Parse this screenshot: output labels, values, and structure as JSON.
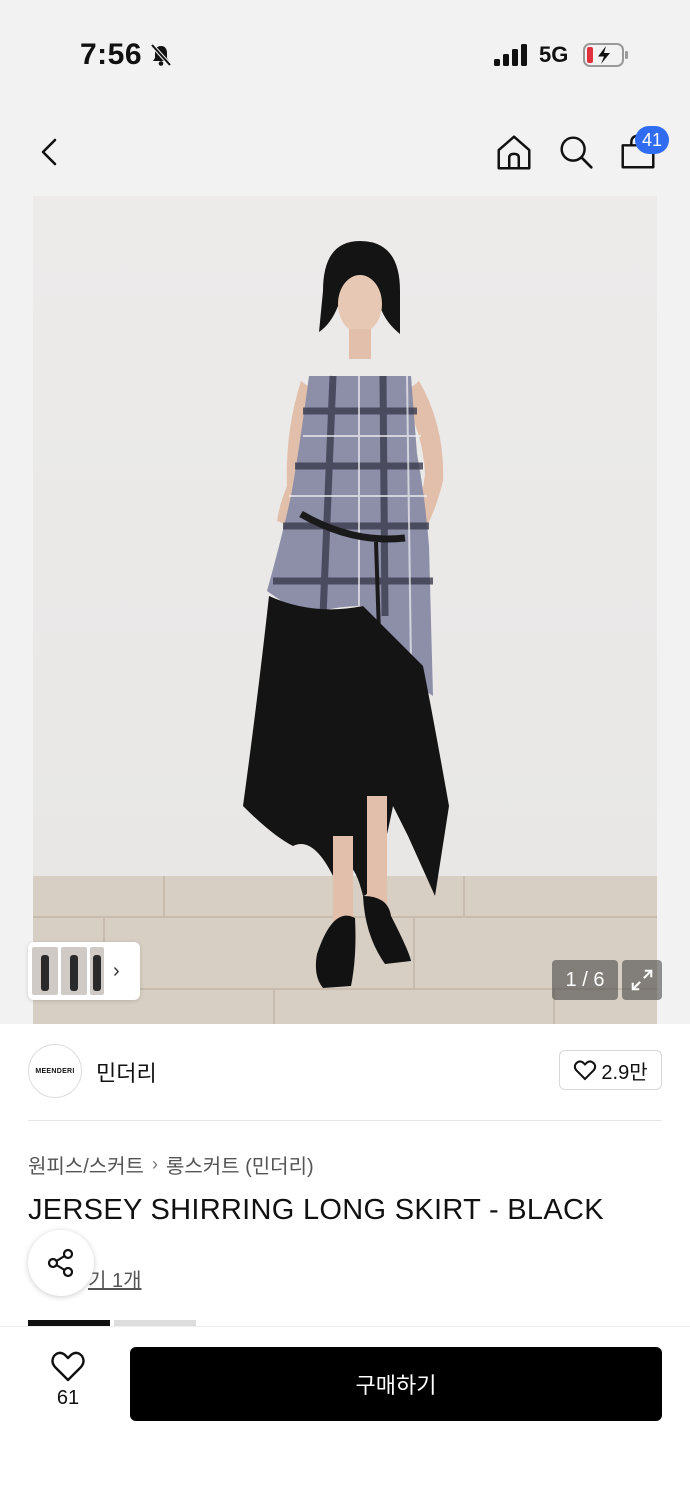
{
  "status_bar": {
    "time": "7:56",
    "network": "5G",
    "icons": [
      "bell-slash-icon",
      "signal-bars-icon",
      "battery-charging-icon"
    ]
  },
  "header": {
    "cart_count": "41",
    "icons": [
      "chevron-left-icon",
      "home-icon",
      "search-icon",
      "shopping-bag-icon"
    ]
  },
  "gallery": {
    "counter": "1 / 6",
    "icons": [
      "chevron-right-icon",
      "expand-icon"
    ]
  },
  "brand": {
    "logo_text": "MEENDERI",
    "name": "민더리",
    "likes": "2.9만"
  },
  "breadcrumb": {
    "items": [
      "원피스/스커트",
      "롱스커트 (민더리)"
    ]
  },
  "product": {
    "title": "JERSEY SHIRRING LONG SKIRT - BLACK",
    "review_link": "기 1개"
  },
  "bottom_bar": {
    "wish_count": "61",
    "buy_label": "구매하기"
  },
  "colors": {
    "badge": "#2f6cf2",
    "buy_button": "#000000"
  }
}
